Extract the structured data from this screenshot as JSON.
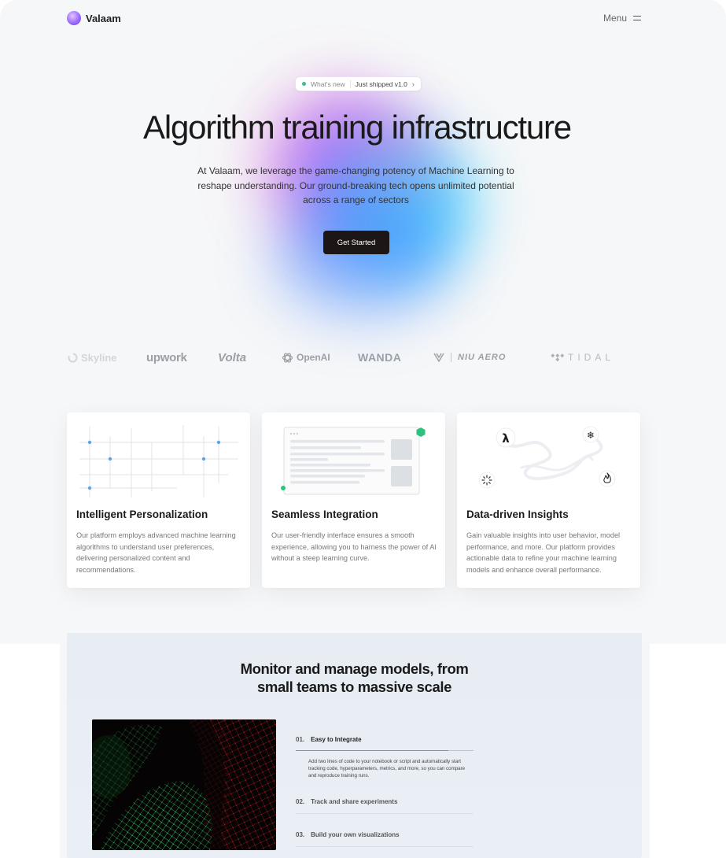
{
  "nav": {
    "brand": "Valaam",
    "menu_label": "Menu"
  },
  "announcement": {
    "tag": "What's new",
    "text": "Just shipped v1.0",
    "chevron": "›"
  },
  "hero": {
    "title": "Algorithm training infrastructure",
    "description": "At Valaam, we leverage the game-changing potency of Machine Learning to reshape understanding. Our ground-breaking tech opens unlimited potential across a range of sectors",
    "cta_label": "Get Started"
  },
  "logos": [
    "Skyline",
    "upwork",
    "Volta",
    "OpenAI",
    "WANDA",
    "NIU AERO",
    "TIDAL"
  ],
  "features": [
    {
      "title": "Intelligent Personalization",
      "description": "Our platform employs advanced machine learning algorithms to understand user preferences, delivering personalized content and recommendations."
    },
    {
      "title": "Seamless Integration",
      "description": "Our user-friendly interface ensures a smooth experience, allowing you to harness the power of AI without a steep learning curve."
    },
    {
      "title": "Data-driven Insights",
      "description": "Gain valuable insights into user behavior, model performance, and more. Our platform provides actionable data to refine your machine learning models and enhance overall performance."
    }
  ],
  "insight_icons": [
    "λ",
    "❄",
    "⁝",
    "fire-icon"
  ],
  "monitor": {
    "title_line1": "Monitor and manage models, from",
    "title_line2": "small teams to massive scale",
    "steps": [
      {
        "num": "01.",
        "label": "Easy to Integrate",
        "body": "Add two lines of code to your notebook or script and automatically start tracking code, hyperparameters, metrics, and more, so you can compare and reproduce training runs."
      },
      {
        "num": "02.",
        "label": "Track and share experiments"
      },
      {
        "num": "03.",
        "label": "Build your own visualizations"
      }
    ]
  },
  "colors": {
    "accent_green": "#2ec27e",
    "node_blue": "#5aa6e6",
    "cta_bg": "#1c1616",
    "logo_gray": "#9aa0a6"
  }
}
